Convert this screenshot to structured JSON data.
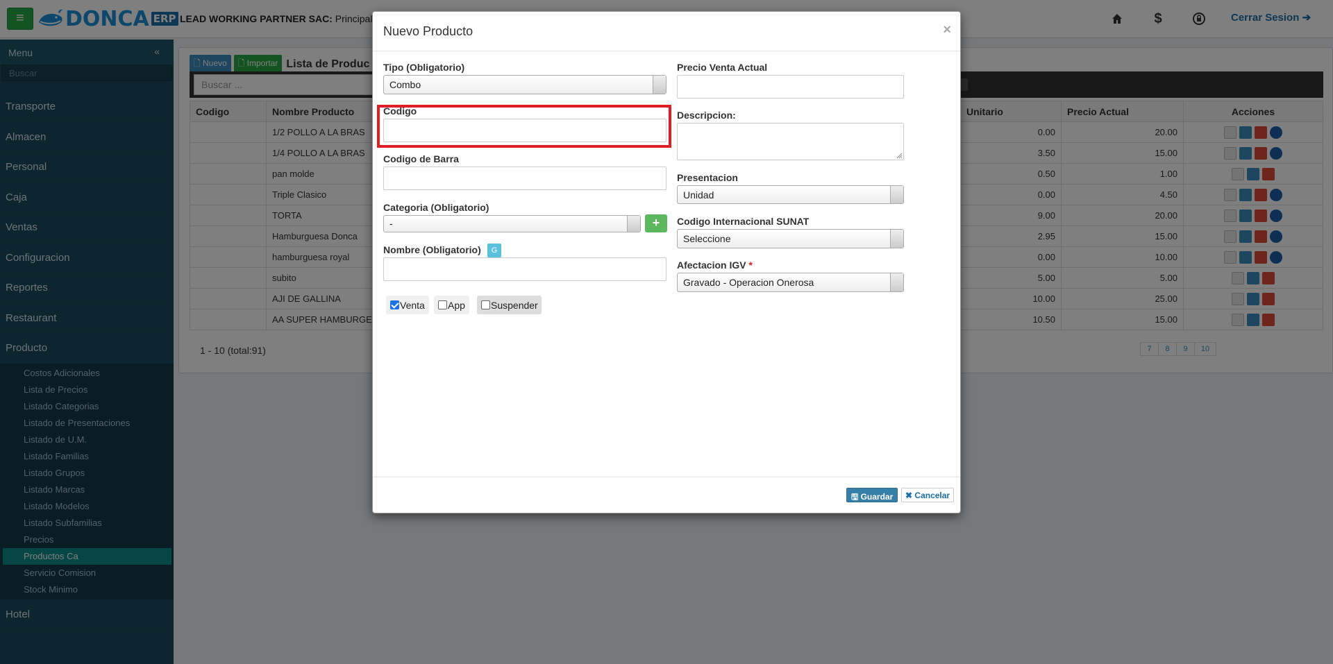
{
  "header": {
    "logo_text": "DONCA",
    "logo_badge": "ERP",
    "company_name": "LEAD WORKING PARTNER SAC:",
    "branch": "Principal",
    "logout_label": "Cerrar Sesion",
    "icons": [
      "menu-icon",
      "home-icon",
      "dollar-icon",
      "lock-icon",
      "logout-icon"
    ]
  },
  "sidebar": {
    "title": "Menu",
    "search_placeholder": "Buscar",
    "items": [
      "Transporte",
      "Almacen",
      "Personal",
      "Caja",
      "Ventas",
      "Configuracion",
      "Reportes",
      "Restaurant",
      "Producto"
    ],
    "producto_subitems": [
      "Costos Adicionales",
      "Lista de Precios",
      "Listado Categorias",
      "Listado de Presentaciones",
      "Listado de U.M.",
      "Listado Familias",
      "Listado Grupos",
      "Listado Marcas",
      "Listado Modelos",
      "Listado Subfamilias",
      "Precios",
      "Productos Ca",
      "Servicio Comision",
      "Stock Minimo"
    ],
    "active_subitem": "Productos Ca",
    "last_item": "Hotel"
  },
  "content": {
    "new_label": "Nuevo",
    "import_label": "Importar",
    "list_title": "Lista de Produc",
    "search_placeholder": "Buscar ...",
    "columns": [
      "Codigo",
      "Nombre Producto",
      "Unitario",
      "Precio Actual",
      "Acciones"
    ],
    "rows": [
      {
        "codigo": "",
        "nombre": "1/2 POLLO A LA BRAS",
        "unitario": "0.00",
        "precio": "20.00"
      },
      {
        "codigo": "",
        "nombre": "1/4 POLLO A LA BRAS",
        "unitario": "3.50",
        "precio": "15.00"
      },
      {
        "codigo": "",
        "nombre": "pan molde",
        "unitario": "0.50",
        "precio": "1.00"
      },
      {
        "codigo": "",
        "nombre": "Triple Clasico",
        "unitario": "0.00",
        "precio": "4.50"
      },
      {
        "codigo": "",
        "nombre": "TORTA",
        "unitario": "9.00",
        "precio": "20.00"
      },
      {
        "codigo": "",
        "nombre": "Hamburguesa Donca",
        "unitario": "2.95",
        "precio": "15.00"
      },
      {
        "codigo": "",
        "nombre": "hamburguesa royal",
        "unitario": "0.00",
        "precio": "10.00"
      },
      {
        "codigo": "",
        "nombre": "subito",
        "unitario": "5.00",
        "precio": "5.00"
      },
      {
        "codigo": "",
        "nombre": "AJI DE GALLINA",
        "unitario": "10.00",
        "precio": "25.00"
      },
      {
        "codigo": "",
        "nombre": "AA SUPER HAMBURGE",
        "unitario": "10.50",
        "precio": "15.00"
      }
    ],
    "pager_info": "1 - 10 (total:91)",
    "pages": [
      "7",
      "8",
      "9",
      "10"
    ]
  },
  "modal": {
    "title": "Nuevo Producto",
    "close_symbol": "×",
    "tipo_label": "Tipo (Obligatorio)",
    "tipo_value": "Combo",
    "codigo_label": "Codigo",
    "codigo_value": "",
    "codigo_barra_label": "Codigo de Barra",
    "codigo_barra_value": "",
    "categoria_label": "Categoria (Obligatorio)",
    "categoria_value": "-",
    "nombre_label": "Nombre (Obligatorio)",
    "nombre_badge": "G",
    "nombre_value": "",
    "checkboxes": [
      {
        "label": "Venta",
        "checked": true
      },
      {
        "label": "App",
        "checked": false
      },
      {
        "label": "Suspender",
        "checked": false
      }
    ],
    "precio_label": "Precio Venta Actual",
    "precio_value": "",
    "descripcion_label": "Descripcion:",
    "presentacion_label": "Presentacion",
    "presentacion_value": "Unidad",
    "sunat_label": "Codigo Internacional SUNAT",
    "sunat_value": "Seleccione",
    "igv_label": "Afectacion IGV",
    "igv_required": "*",
    "igv_value": "Gravado - Operacion Onerosa",
    "save_label": "Guardar",
    "cancel_label": "Cancelar"
  },
  "colors": {
    "highlight": "#e01e26",
    "sidebar_bg": "#1b4a5c",
    "active_item": "#0d8c8a",
    "primary": "#3c8dbc"
  }
}
